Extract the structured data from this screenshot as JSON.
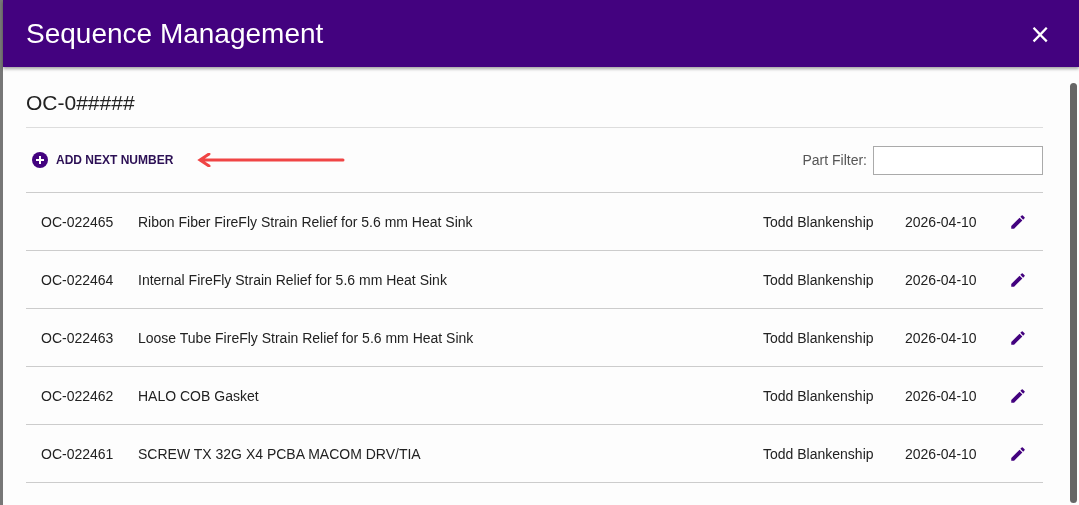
{
  "window": {
    "title": "Sequence Management",
    "close": "×"
  },
  "sequence": {
    "title": "OC-0#####"
  },
  "toolbar": {
    "add_button": "ADD NEXT NUMBER",
    "filter_label": "Part Filter:"
  },
  "table": {
    "rows": [
      {
        "number": "OC-022465",
        "description": "Ribon Fiber FireFly Strain Relief for 5.6 mm Heat Sink",
        "owner": "Todd Blankenship",
        "date": "2026-04-10"
      },
      {
        "number": "OC-022464",
        "description": "Internal FireFly Strain Relief for 5.6 mm Heat Sink",
        "owner": "Todd Blankenship",
        "date": "2026-04-10"
      },
      {
        "number": "OC-022463",
        "description": "Loose Tube FireFly Strain Relief for 5.6 mm Heat Sink",
        "owner": "Todd Blankenship",
        "date": "2026-04-10"
      },
      {
        "number": "OC-022462",
        "description": "HALO COB Gasket",
        "owner": "Todd Blankenship",
        "date": "2026-04-10"
      },
      {
        "number": "OC-022461",
        "description": "SCREW TX 32G X4 PCBA MACOM DRV/TIA",
        "owner": "Todd Blankenship",
        "date": "2026-04-10"
      }
    ]
  }
}
